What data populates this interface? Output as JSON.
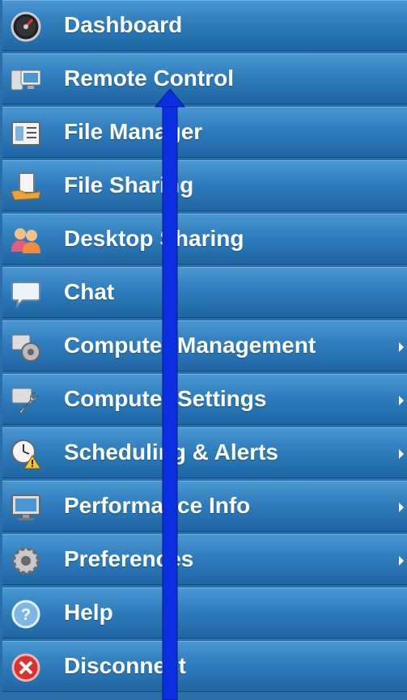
{
  "menu": {
    "items": [
      {
        "label": "Dashboard",
        "icon": "gauge-icon",
        "submenu": false
      },
      {
        "label": "Remote Control",
        "icon": "remote-computer-icon",
        "submenu": false
      },
      {
        "label": "File Manager",
        "icon": "file-manager-icon",
        "submenu": false
      },
      {
        "label": "File Sharing",
        "icon": "file-sharing-icon",
        "submenu": false
      },
      {
        "label": "Desktop Sharing",
        "icon": "users-icon",
        "submenu": false
      },
      {
        "label": "Chat",
        "icon": "chat-bubble-icon",
        "submenu": false
      },
      {
        "label": "Computer Management",
        "icon": "gear-icon",
        "submenu": true
      },
      {
        "label": "Computer Settings",
        "icon": "wrench-icon",
        "submenu": true
      },
      {
        "label": "Scheduling & Alerts",
        "icon": "clock-warning-icon",
        "submenu": true
      },
      {
        "label": "Performance Info",
        "icon": "monitor-icon",
        "submenu": true
      },
      {
        "label": "Preferences",
        "icon": "gears-icon",
        "submenu": true
      },
      {
        "label": "Help",
        "icon": "help-icon",
        "submenu": false
      },
      {
        "label": "Disconnect",
        "icon": "disconnect-icon",
        "submenu": false
      }
    ]
  },
  "colors": {
    "menu_bg": "#2a6fa8",
    "arrow": "#0a2fe0",
    "text": "#ffffff"
  }
}
